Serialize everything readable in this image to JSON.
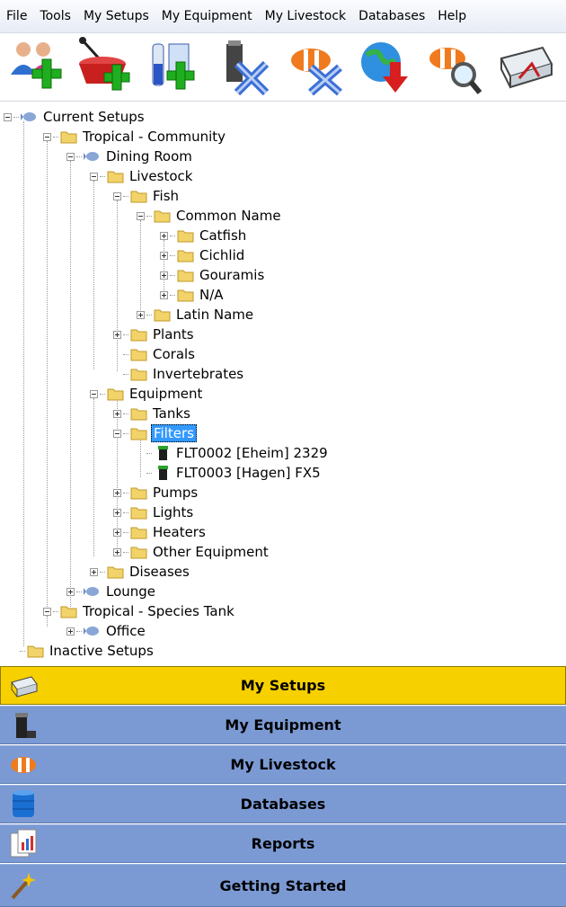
{
  "menu": [
    "File",
    "Tools",
    "My Setups",
    "My Equipment",
    "My Livestock",
    "Databases",
    "Help"
  ],
  "toolbar": [
    {
      "icon": "add-users-icon"
    },
    {
      "icon": "add-tank-icon"
    },
    {
      "icon": "add-test-icon"
    },
    {
      "icon": "remove-equipment-icon"
    },
    {
      "icon": "remove-livestock-icon"
    },
    {
      "icon": "download-icon"
    },
    {
      "icon": "search-livestock-icon"
    },
    {
      "icon": "tank-settings-icon"
    }
  ],
  "tree": {
    "current_setups": "Current Setups",
    "tropical_community": "Tropical - Community",
    "dining_room": "Dining Room",
    "livestock": "Livestock",
    "fish": "Fish",
    "common_name": "Common Name",
    "catfish": "Catfish",
    "cichlid": "Cichlid",
    "gouramis": "Gouramis",
    "na": "N/A",
    "latin_name": "Latin Name",
    "plants": "Plants",
    "corals": "Corals",
    "invertebrates": "Invertebrates",
    "equipment": "Equipment",
    "tanks": "Tanks",
    "filters": "Filters",
    "filter1": "FLT0002 [Eheim] 2329",
    "filter2": "FLT0003 [Hagen] FX5",
    "pumps": "Pumps",
    "lights": "Lights",
    "heaters": "Heaters",
    "other_equipment": "Other Equipment",
    "diseases": "Diseases",
    "lounge": "Lounge",
    "tropical_species": "Tropical - Species Tank",
    "office": "Office",
    "inactive_setups": "Inactive Setups"
  },
  "nav": [
    {
      "label": "My Setups",
      "icon": "tank-icon",
      "active": true
    },
    {
      "label": "My Equipment",
      "icon": "equipment-icon",
      "active": false
    },
    {
      "label": "My Livestock",
      "icon": "clownfish-icon",
      "active": false
    },
    {
      "label": "Databases",
      "icon": "database-icon",
      "active": false
    },
    {
      "label": "Reports",
      "icon": "reports-icon",
      "active": false
    },
    {
      "label": "Getting Started",
      "icon": "magic-wand-icon",
      "active": false
    }
  ],
  "colors": {
    "nav_active": "#f7d000",
    "nav_normal": "#7b9ad4",
    "selection": "#3399ff"
  }
}
